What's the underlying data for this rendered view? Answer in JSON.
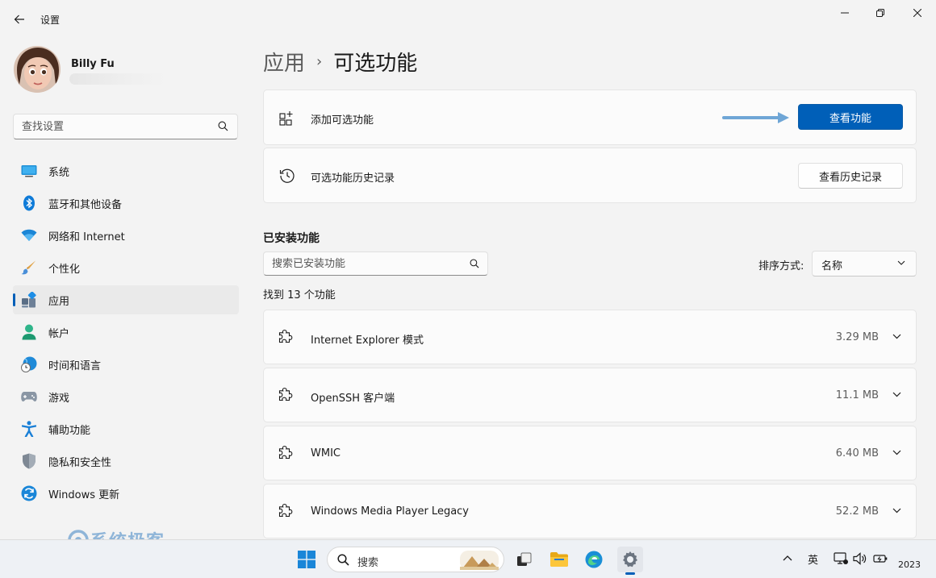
{
  "window": {
    "title": "设置",
    "controls": [
      "minimize-icon",
      "maximize-icon",
      "close-icon"
    ]
  },
  "profile": {
    "name": "Billy Fu"
  },
  "search": {
    "placeholder": "查找设置"
  },
  "sidebar": {
    "items": [
      {
        "label": "系统",
        "icon": "system-icon"
      },
      {
        "label": "蓝牙和其他设备",
        "icon": "bluetooth-icon"
      },
      {
        "label": "网络和 Internet",
        "icon": "wifi-icon"
      },
      {
        "label": "个性化",
        "icon": "brush-icon"
      },
      {
        "label": "应用",
        "icon": "apps-icon",
        "active": true
      },
      {
        "label": "帐户",
        "icon": "account-icon"
      },
      {
        "label": "时间和语言",
        "icon": "time-language-icon"
      },
      {
        "label": "游戏",
        "icon": "gamepad-icon"
      },
      {
        "label": "辅助功能",
        "icon": "accessibility-icon"
      },
      {
        "label": "隐私和安全性",
        "icon": "shield-icon"
      },
      {
        "label": "Windows 更新",
        "icon": "windows-update-icon"
      }
    ]
  },
  "breadcrumb": {
    "parent": "应用",
    "separator": "›",
    "current": "可选功能"
  },
  "add_feature": {
    "label": "添加可选功能",
    "button": "查看功能"
  },
  "history": {
    "label": "可选功能历史记录",
    "button": "查看历史记录"
  },
  "installed": {
    "title": "已安装功能",
    "search_placeholder": "搜索已安装功能",
    "sort_label": "排序方式:",
    "sort_value": "名称",
    "found_text": "找到 13 个功能",
    "features": [
      {
        "name": "Internet Explorer 模式",
        "size": "3.29 MB"
      },
      {
        "name": "OpenSSH 客户端",
        "size": "11.1 MB"
      },
      {
        "name": "WMIC",
        "size": "6.40 MB"
      },
      {
        "name": "Windows Media Player Legacy",
        "size": "52.2 MB"
      }
    ]
  },
  "watermark": {
    "text": "系统极客"
  },
  "taskbar": {
    "search_label": "搜索",
    "language": "英",
    "year": "2023",
    "accent": "#005fb8"
  }
}
